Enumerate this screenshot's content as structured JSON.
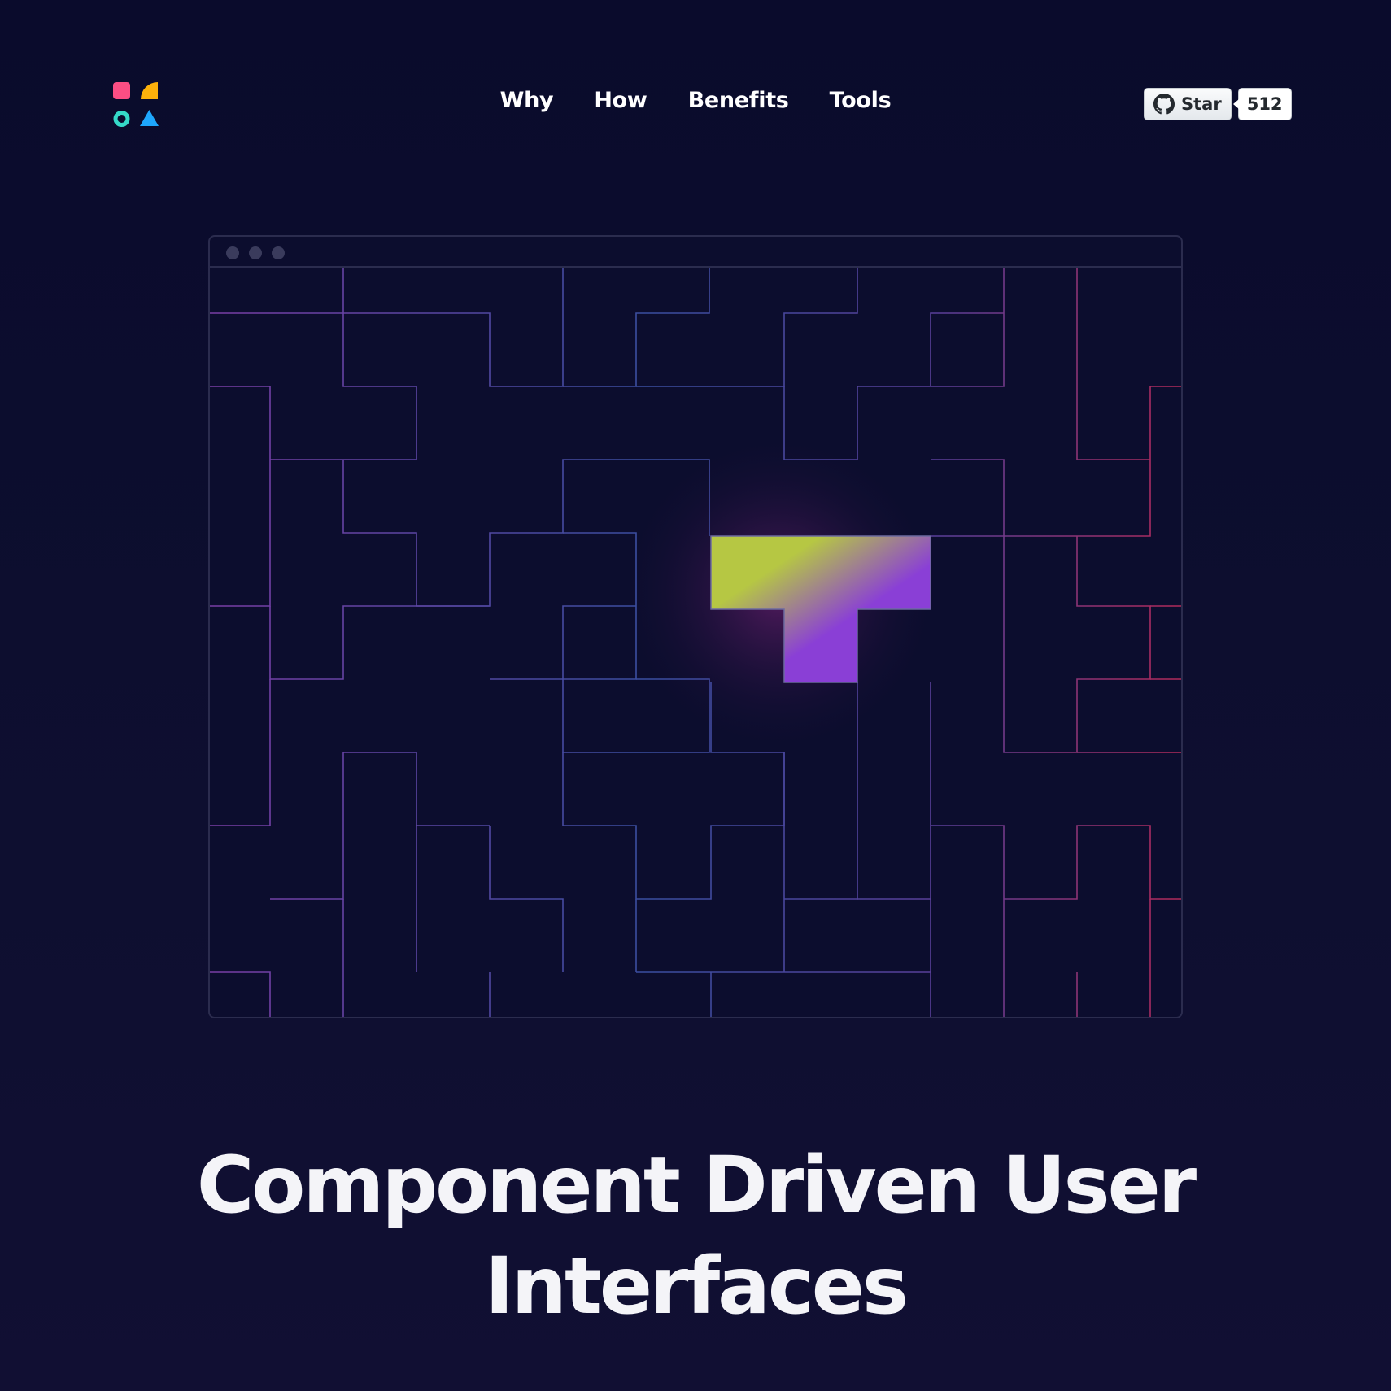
{
  "logo": {
    "icon": "component-driven-logo",
    "colors": {
      "square": "#fb4e84",
      "quarter": "#fdb10b",
      "circle": "#35d9c8",
      "triangle": "#1ea7fd"
    }
  },
  "nav": {
    "items": [
      {
        "label": "Why"
      },
      {
        "label": "How"
      },
      {
        "label": "Benefits"
      },
      {
        "label": "Tools"
      }
    ]
  },
  "github": {
    "star_label": "Star",
    "star_count": "512",
    "icon": "github-icon"
  },
  "hero": {
    "illustration": "browser-window-with-puzzle-pieces",
    "highlight_colors": [
      "#b6c743",
      "#8a3fd6"
    ],
    "headline_line1": "Component Driven User",
    "headline_line2": "Interfaces",
    "subtext": ""
  }
}
